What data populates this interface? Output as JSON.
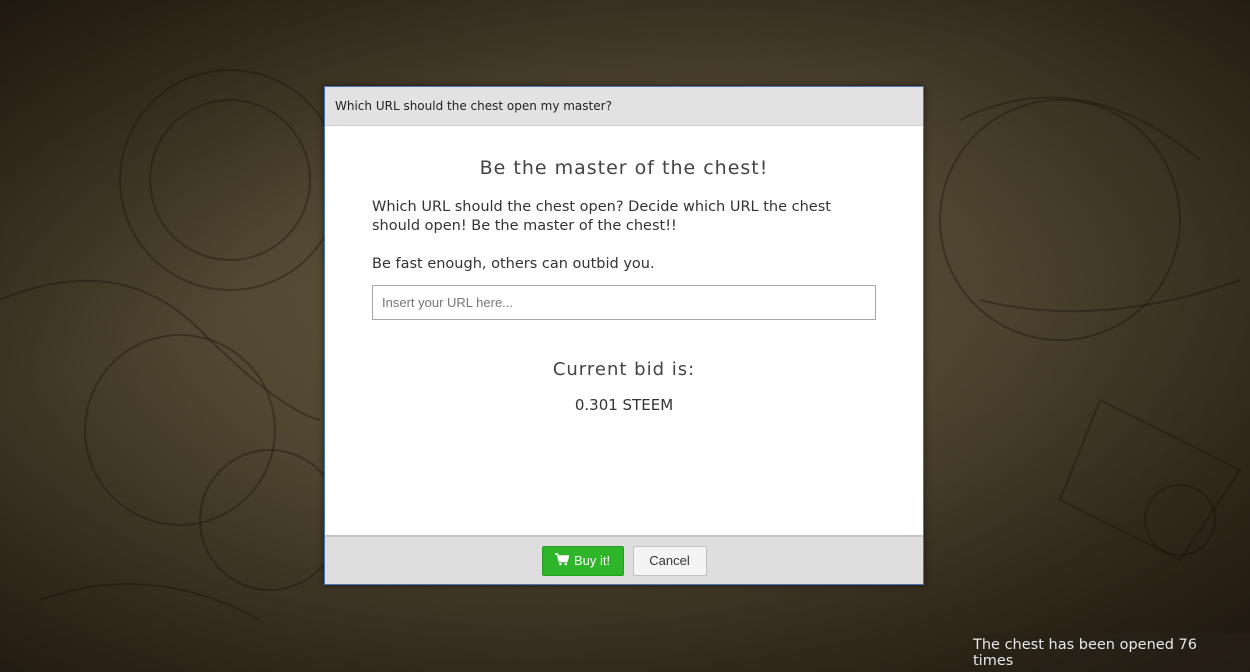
{
  "modal": {
    "header_title": "Which URL should the chest open my master?",
    "heading": "Be the master of the chest!",
    "description": "Which URL should the chest open? Decide which URL the chest should open! Be the master of the chest!!",
    "warning": "Be fast enough, others can outbid you.",
    "url_input": {
      "value": "",
      "placeholder": "Insert your URL here..."
    },
    "bid_label": "Current bid is:",
    "bid_value": "0.301 STEEM",
    "buttons": {
      "buy_label": "Buy it!",
      "buy_icon": "shopping-cart-icon",
      "cancel_label": "Cancel"
    }
  },
  "status": {
    "counter_text": "The chest has been opened 76 times"
  },
  "colors": {
    "buy_button": "#2fb52a",
    "modal_border": "#4a74b8",
    "header_bg": "#e2e2e2",
    "footer_bg": "#dedede"
  }
}
